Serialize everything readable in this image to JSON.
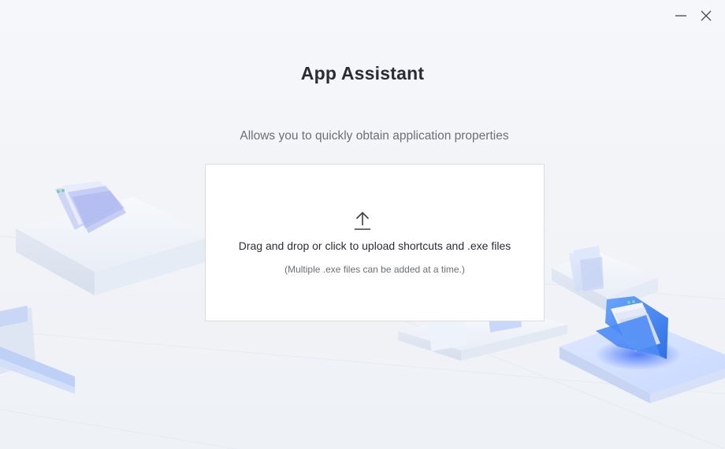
{
  "window": {
    "title": "App Assistant",
    "subtitle": "Allows you to quickly obtain application properties",
    "controls": {
      "minimize_icon": "minimize-icon",
      "close_icon": "close-icon"
    }
  },
  "dropzone": {
    "icon": "upload-icon",
    "label": "Drag and drop or click to upload shortcuts and .exe files",
    "hint": "(Multiple .exe files can be added at a time.)"
  },
  "colors": {
    "background": "#f3f5f8",
    "title": "#2a2d33",
    "subtitle": "#6b6f78",
    "accent_blue": "#3d7cf2",
    "dropzone_border": "#d9dce2"
  }
}
